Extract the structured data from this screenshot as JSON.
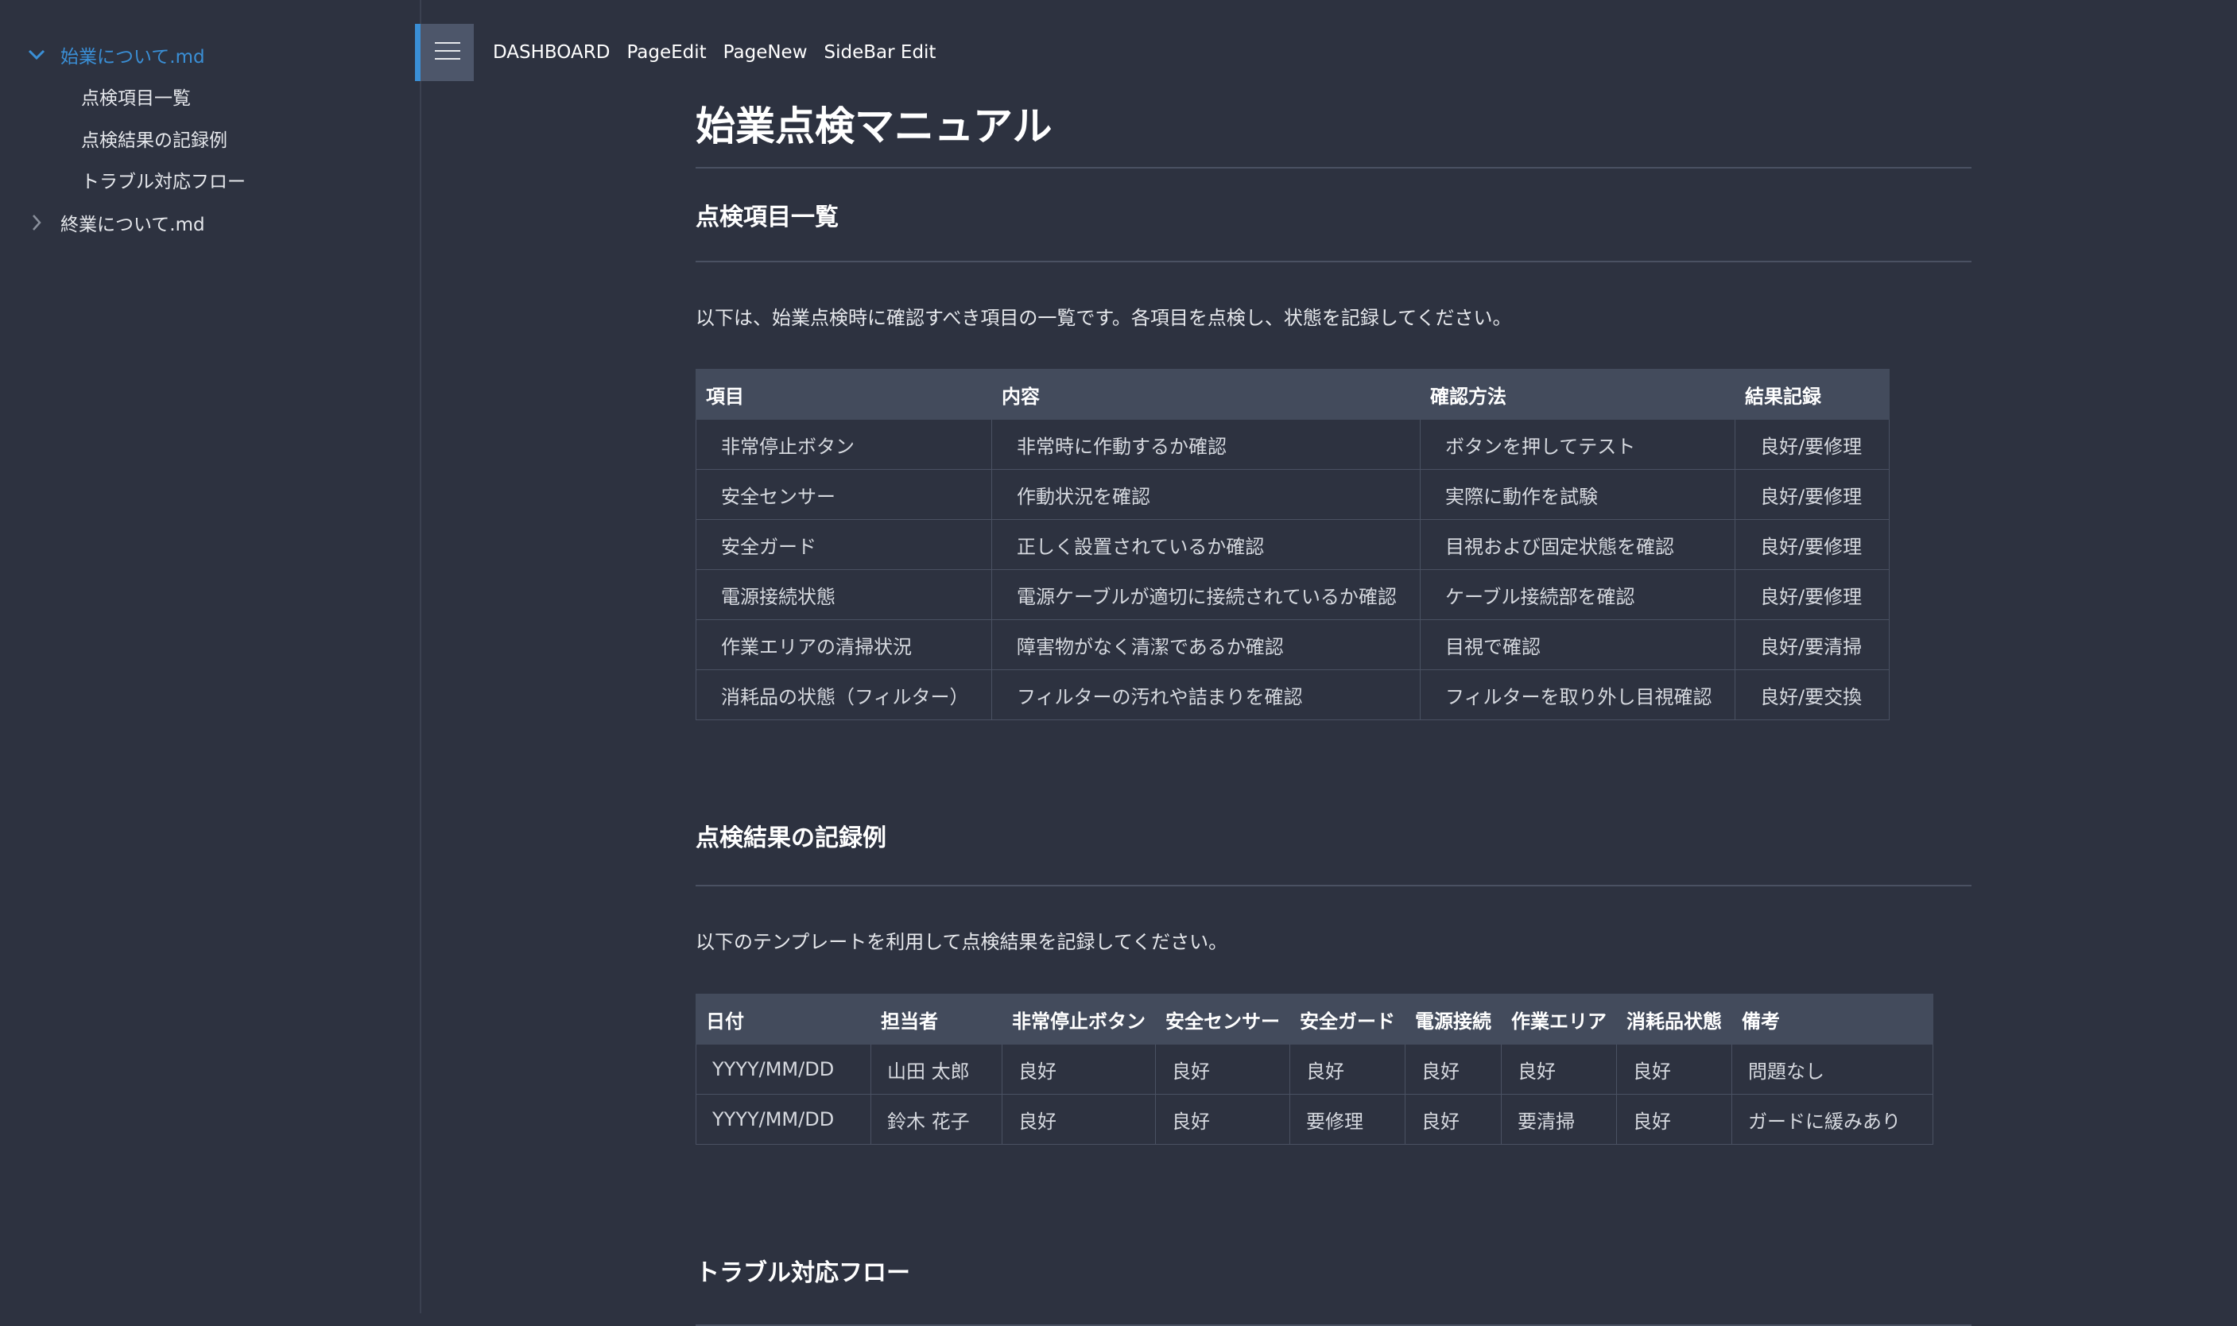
{
  "sidebar": {
    "items": [
      {
        "label": "始業について.md",
        "expanded": true,
        "children": [
          {
            "label": "点検項目一覧"
          },
          {
            "label": "点検結果の記録例"
          },
          {
            "label": "トラブル対応フロー"
          }
        ]
      },
      {
        "label": "終業について.md",
        "expanded": false,
        "children": []
      }
    ]
  },
  "header": {
    "menu_icon": "hamburger-menu-icon",
    "nav": [
      "DASHBOARD",
      "PageEdit",
      "PageNew",
      "SideBar Edit"
    ]
  },
  "main": {
    "title": "始業点検マニュアル",
    "sections": [
      {
        "heading": "点検項目一覧",
        "description": "以下は、始業点検時に確認すべき項目の一覧です。各項目を点検し、状態を記録してください。",
        "table": {
          "columns": [
            "項目",
            "内容",
            "確認方法",
            "結果記録"
          ],
          "rows": [
            [
              "非常停止ボタン",
              "非常時に作動するか確認",
              "ボタンを押してテスト",
              "良好/要修理"
            ],
            [
              "安全センサー",
              "作動状況を確認",
              "実際に動作を試験",
              "良好/要修理"
            ],
            [
              "安全ガード",
              "正しく設置されているか確認",
              "目視および固定状態を確認",
              "良好/要修理"
            ],
            [
              "電源接続状態",
              "電源ケーブルが適切に接続されているか確認",
              "ケーブル接続部を確認",
              "良好/要修理"
            ],
            [
              "作業エリアの清掃状況",
              "障害物がなく清潔であるか確認",
              "目視で確認",
              "良好/要清掃"
            ],
            [
              "消耗品の状態（フィルター）",
              "フィルターの汚れや詰まりを確認",
              "フィルターを取り外し目視確認",
              "良好/要交換"
            ]
          ]
        }
      },
      {
        "heading": "点検結果の記録例",
        "description": "以下のテンプレートを利用して点検結果を記録してください。",
        "table": {
          "columns": [
            "日付",
            "担当者",
            "非常停止ボタン",
            "安全センサー",
            "安全ガード",
            "電源接続",
            "作業エリア",
            "消耗品状態",
            "備考"
          ],
          "rows": [
            [
              "YYYY/MM/DD",
              "山田 太郎",
              "良好",
              "良好",
              "良好",
              "良好",
              "良好",
              "良好",
              "問題なし"
            ],
            [
              "YYYY/MM/DD",
              "鈴木 花子",
              "良好",
              "良好",
              "要修理",
              "良好",
              "要清掃",
              "良好",
              "ガードに緩みあり"
            ]
          ]
        }
      },
      {
        "heading": "トラブル対応フロー"
      }
    ]
  },
  "colors": {
    "background": "#2d3240",
    "accent": "#3a8fd6",
    "table_header": "#434b5c",
    "border": "#4a5162"
  }
}
